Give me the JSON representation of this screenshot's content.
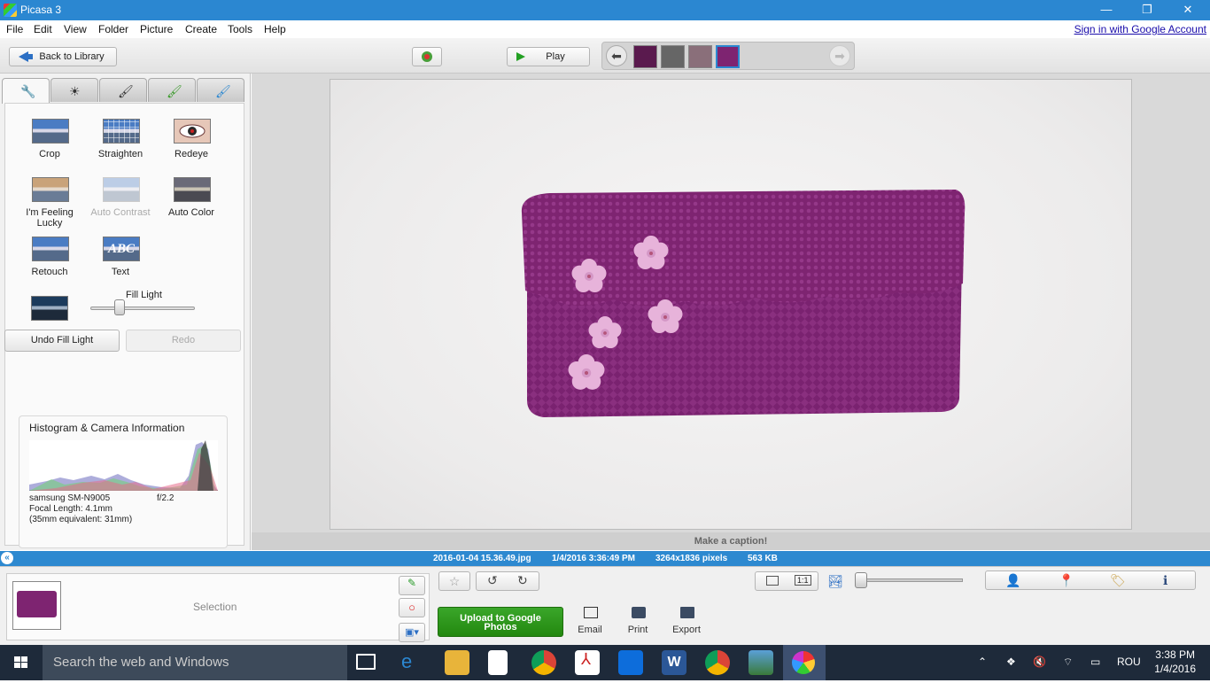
{
  "window": {
    "title": "Picasa 3",
    "controls": [
      "—",
      "❐",
      "✕"
    ]
  },
  "menu": {
    "items": [
      "File",
      "Edit",
      "View",
      "Folder",
      "Picture",
      "Create",
      "Tools",
      "Help"
    ],
    "signin": "Sign in with Google Account"
  },
  "toolbar": {
    "back_label": "Back to Library",
    "play_label": "Play",
    "layout_labels": [
      "A",
      "A B",
      "A A"
    ]
  },
  "tabs": [
    "wrench-icon",
    "sun-icon",
    "brush-icon",
    "brush-green-icon",
    "brush-blue-icon"
  ],
  "tools": {
    "crop": "Crop",
    "straighten": "Straighten",
    "redeye": "Redeye",
    "lucky": "I'm Feeling Lucky",
    "auto_contrast": "Auto Contrast",
    "auto_color": "Auto Color",
    "retouch": "Retouch",
    "text": "Text",
    "text_thumb": "ABC",
    "fill_light": "Fill Light",
    "fill_light_value": 0.3,
    "undo": "Undo Fill Light",
    "redo": "Redo"
  },
  "histogram": {
    "title": "Histogram & Camera Information",
    "camera": "samsung SM-N9005",
    "aperture": "f/2.2",
    "focal": "Focal Length: 4.1mm",
    "equiv": "(35mm equivalent:  31mm)"
  },
  "caption": "Make a caption!",
  "status": {
    "filename": "2016-01-04 15.36.49.jpg",
    "date": "1/4/2016 3:36:49 PM",
    "dims": "3264x1836 pixels",
    "size": "563 KB"
  },
  "tray": {
    "selection": "Selection",
    "upload_line1": "Upload to Google",
    "upload_line2": "Photos",
    "email": "Email",
    "print": "Print",
    "export": "Export",
    "zoom_btn2": "1:1"
  },
  "taskbar": {
    "search": "Search the web and Windows",
    "lang": "ROU",
    "time": "3:38 PM",
    "date": "1/4/2016"
  },
  "colors": {
    "accent": "#2b87d1",
    "bag": "#7e2471",
    "flower": "#e2a9d4",
    "upload": "#2d9a1d"
  }
}
